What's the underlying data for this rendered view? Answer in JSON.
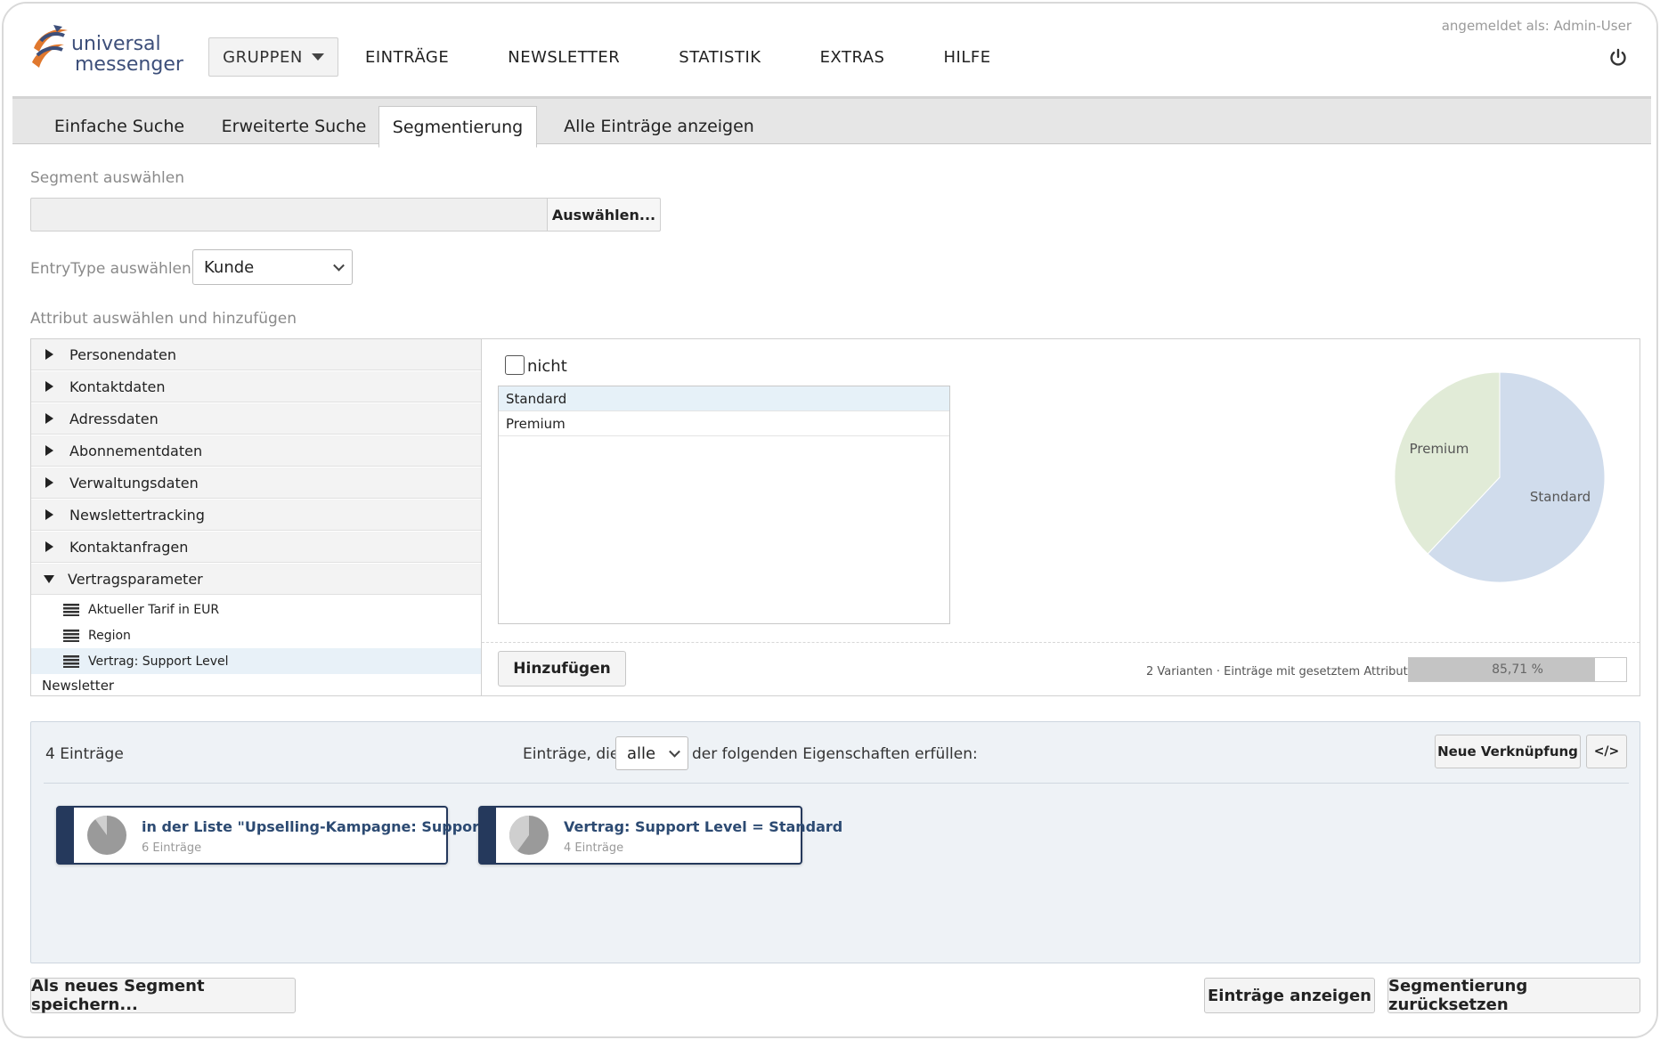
{
  "header": {
    "logo_line1": "universal",
    "logo_line2": "messenger",
    "login_text": "angemeldet als: Admin-User",
    "nav": {
      "groups": "GRUPPEN",
      "entries": "EINTRÄGE",
      "newsletter": "NEWSLETTER",
      "statistics": "STATISTIK",
      "extras": "EXTRAS",
      "help": "HILFE"
    }
  },
  "tabs": [
    {
      "label": "Einfache Suche"
    },
    {
      "label": "Erweiterte Suche"
    },
    {
      "label": "Segmentierung",
      "active": true
    },
    {
      "label": "Alle Einträge anzeigen"
    }
  ],
  "segment": {
    "label": "Segment auswählen",
    "input_value": "",
    "select_button": "Auswählen..."
  },
  "entry_type": {
    "label": "EntryType auswählen",
    "value": "Kunde"
  },
  "attribute": {
    "label": "Attribut auswählen und hinzufügen",
    "tree": [
      {
        "label": "Personendaten",
        "expanded": false
      },
      {
        "label": "Kontaktdaten",
        "expanded": false
      },
      {
        "label": "Adressdaten",
        "expanded": false
      },
      {
        "label": "Abonnementdaten",
        "expanded": false
      },
      {
        "label": "Verwaltungsdaten",
        "expanded": false
      },
      {
        "label": "Newslettertracking",
        "expanded": false
      },
      {
        "label": "Kontaktanfragen",
        "expanded": false
      },
      {
        "label": "Vertragsparameter",
        "expanded": true
      }
    ],
    "leaves": [
      {
        "label": "Aktueller Tarif in EUR"
      },
      {
        "label": "Region"
      },
      {
        "label": "Vertrag: Support Level",
        "selected": true
      }
    ],
    "tree_footer": "Newsletter",
    "not_label": "nicht",
    "not_checked": false,
    "values": [
      {
        "label": "Standard",
        "selected": true
      },
      {
        "label": "Premium"
      }
    ],
    "add_button": "Hinzufügen",
    "variants_text": "2 Varianten · Einträge mit gesetztem Attribut:",
    "progress_label": "85,71 %",
    "progress_value": 0.8571
  },
  "chart_data": {
    "type": "pie",
    "labels": [
      "Standard",
      "Premium"
    ],
    "values": [
      62,
      38
    ],
    "colors": [
      "#d0dcec",
      "#e1ebd7"
    ]
  },
  "results": {
    "count_label": "4 Einträge",
    "condition_prefix": "Einträge, die",
    "condition_value": "alle",
    "condition_suffix": "der folgenden Eigenschaften erfüllen:",
    "new_link_button": "Neue Verknüpfung",
    "code_button": "</>",
    "cards": [
      {
        "title": "in der Liste \"Upselling-Kampagne: Support\"",
        "sub": "6 Einträge",
        "share": 0.9
      },
      {
        "title": "Vertrag: Support Level = Standard",
        "sub": "4 Einträge",
        "share": 0.6
      }
    ]
  },
  "footer": {
    "save_button": "Als neues Segment speichern...",
    "show_button": "Einträge anzeigen",
    "reset_button": "Segmentierung zurücksetzen"
  },
  "colors": {
    "brand_blue": "#25395c",
    "logo_orange": "#e0782e",
    "logo_blue": "#3d4f7a"
  }
}
